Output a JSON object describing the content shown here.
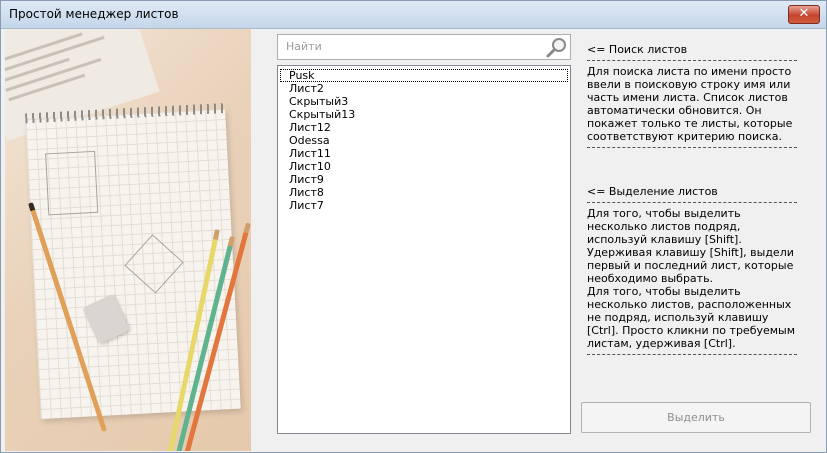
{
  "window": {
    "title": "Простой менеджер листов",
    "close_symbol": "✕"
  },
  "search": {
    "placeholder": "Найти",
    "value": ""
  },
  "sheets": [
    {
      "name": "Pusk",
      "focused": true
    },
    {
      "name": "Лист2"
    },
    {
      "name": "Скрытый3"
    },
    {
      "name": "Скрытый13"
    },
    {
      "name": "Лист12"
    },
    {
      "name": "Odessa"
    },
    {
      "name": "Лист11"
    },
    {
      "name": "Лист10"
    },
    {
      "name": "Лист9"
    },
    {
      "name": "Лист8"
    },
    {
      "name": "Лист7"
    }
  ],
  "help": {
    "search_heading": "<= Поиск листов",
    "search_text": "Для поиска листа по имени просто ввели в поисковую строку имя или часть имени листа. Список листов автоматически обновится. Он покажет только те листы, которые соответствуют критерию поиска.",
    "select_heading": "<= Выделение листов",
    "select_text": "Для того, чтобы выделить несколько листов подряд, используй клавишу [Shift]. Удерживая клавишу [Shift], выдели первый и последний лист, которые необходимо выбрать.\nДля того, чтобы выделить несколько листов, расположенных не подряд, используй клавишу [Ctrl]. Просто кликни по требуемым листам, удерживая [Ctrl]."
  },
  "actions": {
    "select_label": "Выделить",
    "select_enabled": false
  },
  "icons": {
    "close": "close-icon",
    "search": "search-icon"
  },
  "colors": {
    "close_button": "#c4452f",
    "titlebar": "#c5d6ea",
    "disabled_text": "#8f8f8f"
  }
}
